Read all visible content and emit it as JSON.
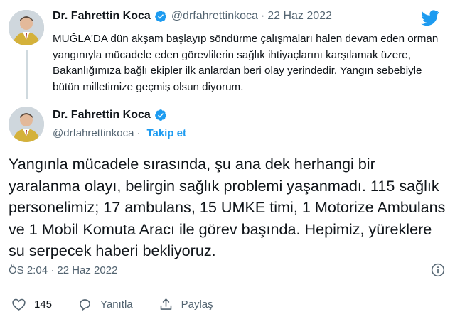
{
  "tweet1": {
    "name": "Dr. Fahrettin Koca",
    "handle": "@drfahrettinkoca",
    "separator": "·",
    "date": "22 Haz 2022",
    "text": "MUĞLA'DA dün akşam başlayıp söndürme çalışmaları halen devam eden orman yangınıyla mücadele eden görevlilerin sağlık ihtiyaçlarını karşılamak üzere, Bakanlığımıza bağlı ekipler ilk anlardan beri olay yerindedir. Yangın sebebiyle bütün milletimize geçmiş olsun diyorum."
  },
  "tweet2": {
    "name": "Dr. Fahrettin Koca",
    "handle": "@drfahrettinkoca",
    "separator": "·",
    "follow_label": "Takip et",
    "text": "Yangınla mücadele sırasında, şu ana dek herhangi bir yaralanma olayı, belirgin sağlık problemi yaşanmadı. 115 sağlık personelimiz; 17 ambulans, 15 UMKE timi, 1 Motorize Ambulans ve 1 Mobil Komuta Aracı ile görev başında. Hepimiz, yüreklere su serpecek haberi bekliyoruz.",
    "timestamp": "ÖS 2:04 · 22 Haz 2022",
    "like_count": "145",
    "reply_label": "Yanıtla",
    "share_label": "Paylaş"
  },
  "icons": {
    "brand": "twitter-bird-icon",
    "verified": "verified-badge-icon",
    "info": "info-icon",
    "like": "heart-icon",
    "reply": "reply-bubble-icon",
    "share": "share-icon"
  },
  "colors": {
    "twitter_blue": "#1d9bf0",
    "secondary_text": "#536471",
    "primary_text": "#0f1419",
    "divider": "#eff3f4"
  }
}
